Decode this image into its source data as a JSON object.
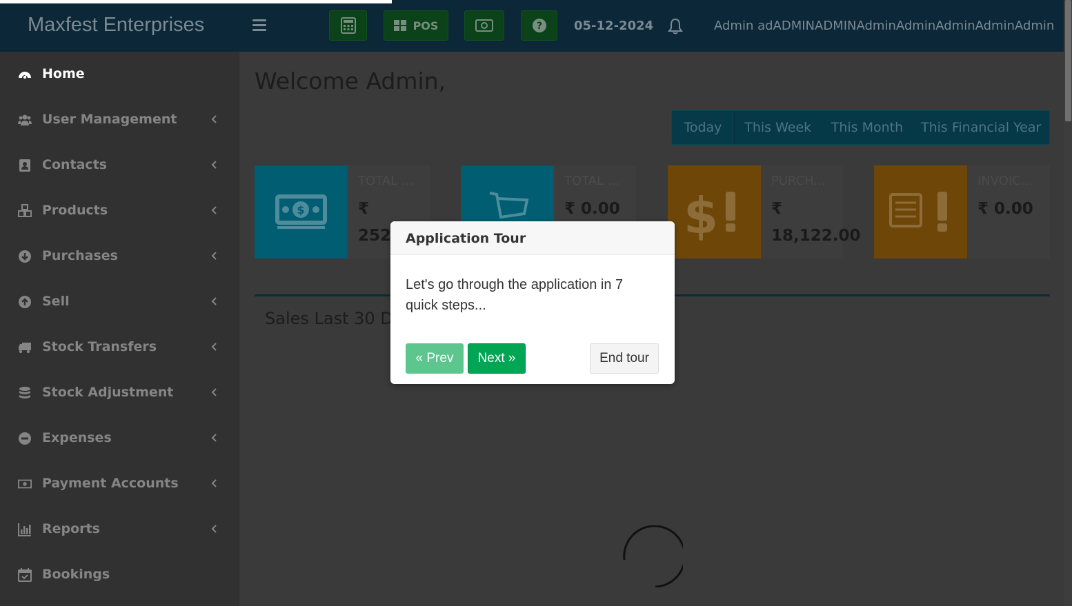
{
  "header": {
    "brand": "Maxfest Enterprises",
    "pos_label": "POS",
    "date": "05-12-2024",
    "user": "Admin adADMINADMINAdminAdminAdminAdminAdmin"
  },
  "sidebar": {
    "items": [
      {
        "label": "Home",
        "icon": "dashboard-icon"
      },
      {
        "label": "User Management",
        "icon": "users-icon"
      },
      {
        "label": "Contacts",
        "icon": "address-book-icon"
      },
      {
        "label": "Products",
        "icon": "cubes-icon"
      },
      {
        "label": "Purchases",
        "icon": "arrow-circle-down-icon"
      },
      {
        "label": "Sell",
        "icon": "arrow-circle-up-icon"
      },
      {
        "label": "Stock Transfers",
        "icon": "truck-icon"
      },
      {
        "label": "Stock Adjustment",
        "icon": "database-icon"
      },
      {
        "label": "Expenses",
        "icon": "minus-circle-icon"
      },
      {
        "label": "Payment Accounts",
        "icon": "money-icon"
      },
      {
        "label": "Reports",
        "icon": "bar-chart-icon"
      },
      {
        "label": "Bookings",
        "icon": "calendar-check-icon"
      }
    ]
  },
  "main": {
    "welcome": "Welcome Admin,",
    "ranges": [
      "Today",
      "This Week",
      "This Month",
      "This Financial Year"
    ],
    "cards": [
      {
        "title": "TOTAL ...",
        "value_line1": "₹",
        "value_line2": "252,"
      },
      {
        "title": "TOTAL ...",
        "value_line1": "₹ 0.00",
        "value_line2": ""
      },
      {
        "title": "PURCH...",
        "value_line1": "₹",
        "value_line2": "18,122.00"
      },
      {
        "title": "INVOIC...",
        "value_line1": "₹ 0.00",
        "value_line2": ""
      }
    ],
    "chart_title": "Sales Last 30 Days"
  },
  "tour": {
    "title": "Application Tour",
    "body": "Let's go through the application in 7 quick steps...",
    "prev": "« Prev",
    "next": "Next »",
    "end": "End tour"
  },
  "colors": {
    "header": "#0c2737",
    "card_teal": "#005d72",
    "card_orange": "#6e4708",
    "tour_next": "#00a654"
  }
}
